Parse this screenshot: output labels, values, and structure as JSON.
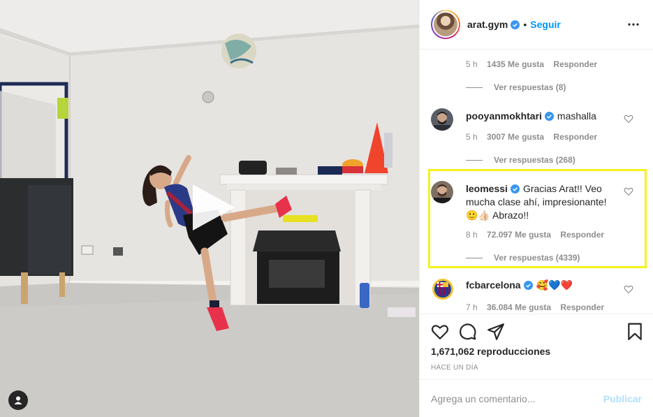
{
  "post": {
    "username": "arat.gym",
    "follow_label": "Seguir",
    "separator": "•",
    "more_icon": "more-horizontal-icon",
    "views": "1,671,062 reproducciones",
    "posted_ago": "HACE UN DÍA"
  },
  "comments": [
    {
      "time": "5 h",
      "likes": "1435 Me gusta",
      "reply": "Responder",
      "view_replies": "Ver respuestas (8)"
    },
    {
      "username": "pooyanmokhtari",
      "text": "mashalla",
      "time": "5 h",
      "likes": "3007 Me gusta",
      "reply": "Responder",
      "view_replies": "Ver respuestas (268)"
    },
    {
      "username": "leomessi",
      "text": "Gracias Arat!! Veo mucha clase ahí, impresionante! 🙂👍🏻 Abrazo!!",
      "time": "8 h",
      "likes": "72.097 Me gusta",
      "reply": "Responder",
      "view_replies": "Ver respuestas (4339)"
    },
    {
      "username": "fcbarcelona",
      "text": "🥰💙❤️",
      "time": "7 h",
      "likes": "36.084 Me gusta",
      "reply": "Responder"
    }
  ],
  "add_comment": {
    "placeholder": "Agrega un comentario...",
    "publish_label": "Publicar"
  },
  "colors": {
    "accent": "#0095f6",
    "verified": "#3897f0",
    "highlight": "#f5f21a",
    "publish_disabled": "#b2dffc"
  },
  "icons": [
    "play-icon",
    "user-tag-icon",
    "heart-icon",
    "comment-icon",
    "share-icon",
    "bookmark-icon",
    "verified-badge-icon"
  ]
}
